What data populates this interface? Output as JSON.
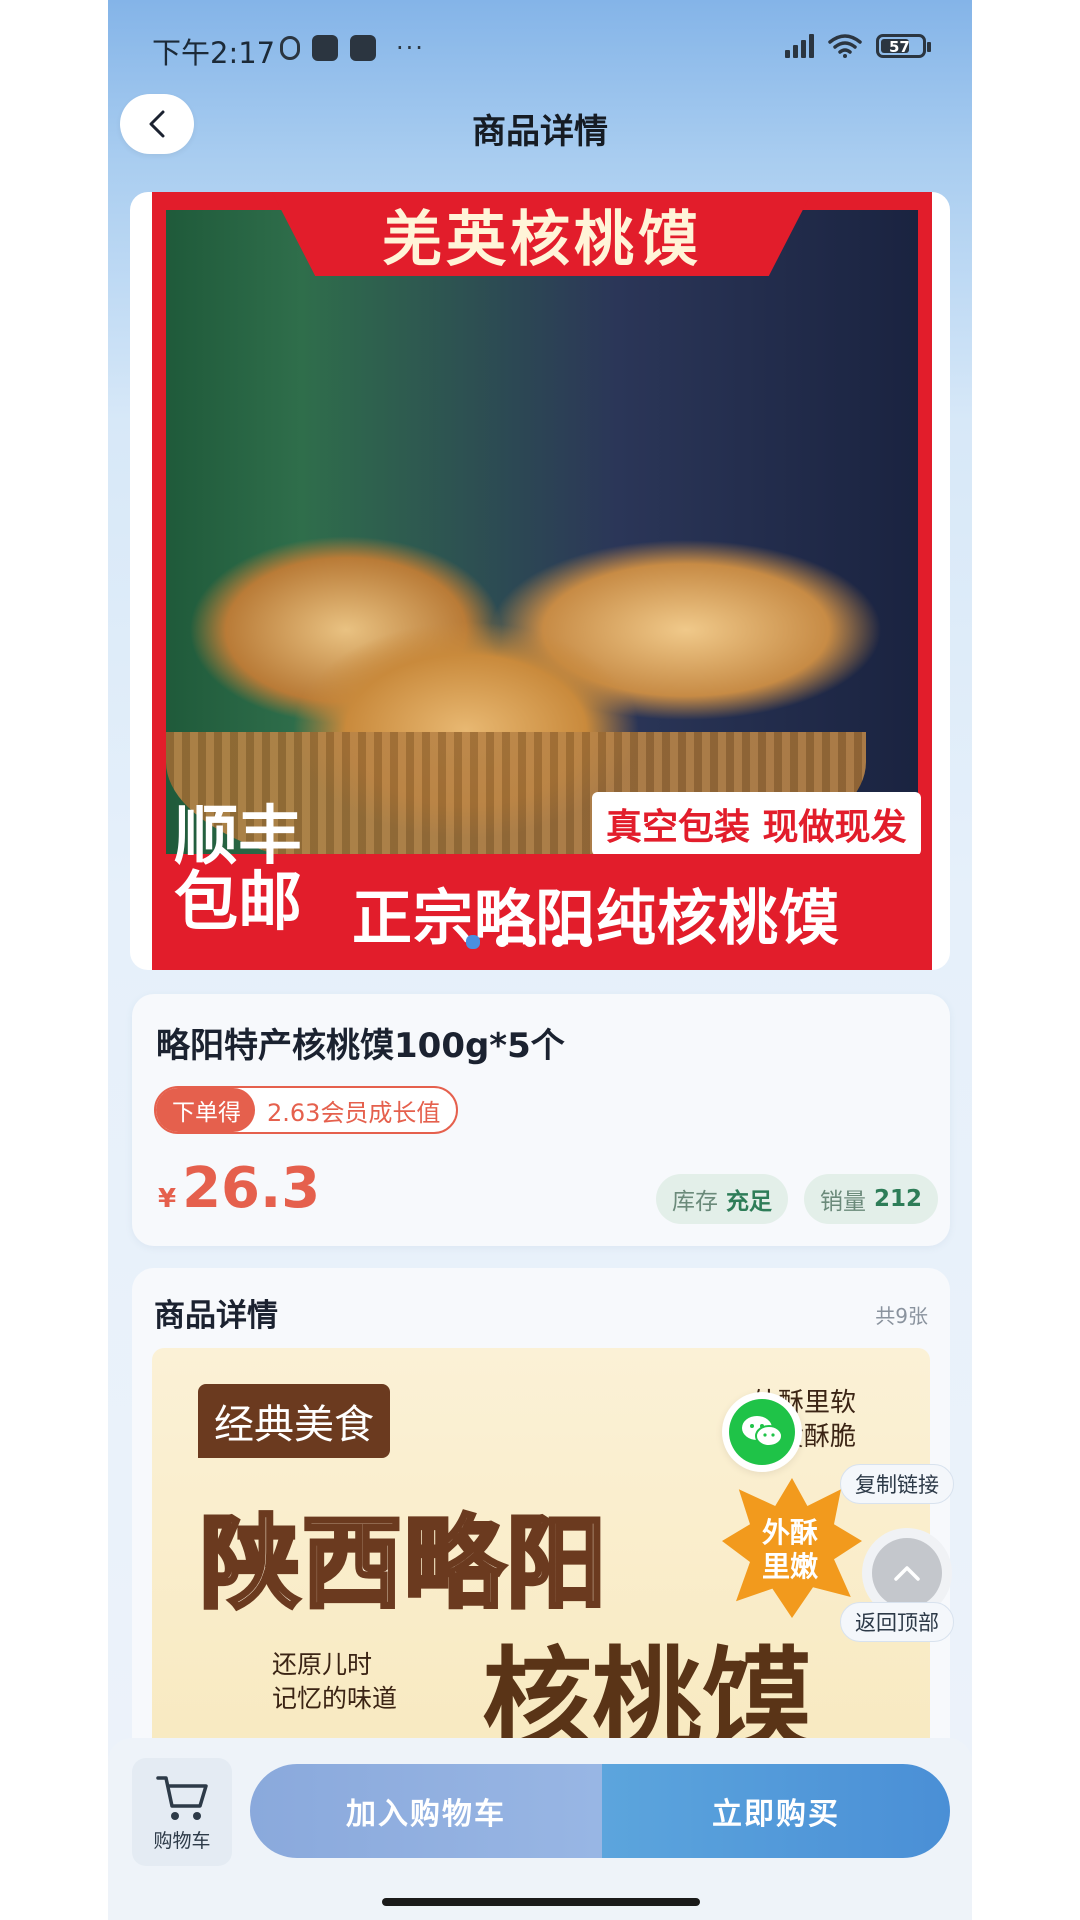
{
  "status_bar": {
    "time": "下午2:17",
    "battery": "57",
    "more": "···"
  },
  "header": {
    "title": "商品详情"
  },
  "hero": {
    "banner_top": "羌英核桃馍",
    "tag": "真空包装 现做现发",
    "shipping": "顺丰包邮",
    "main_text": "正宗略阳纯核桃馍",
    "slide_count": 5,
    "active_slide": 1
  },
  "product": {
    "name": "略阳特产核桃馍100g*5个",
    "growth_prefix": "下单得",
    "growth_value": "2.63会员成长值",
    "price_symbol": "¥",
    "price": "26.3",
    "stock_key": "库存",
    "stock_value": "充足",
    "sales_key": "销量",
    "sales_value": "212"
  },
  "details": {
    "title": "商品详情",
    "count": "共9张",
    "image": {
      "tag": "经典美食",
      "title": "陕西略阳",
      "subtitle_line1": "还原儿时",
      "subtitle_line2": "记忆的味道",
      "big": "核桃馍",
      "crisp_line1": "外酥里软",
      "crisp_line2": "金黄酥脆",
      "star_line1": "外酥",
      "star_line2": "里嫩"
    }
  },
  "floating": {
    "copy_link": "复制链接",
    "back_top": "返回顶部"
  },
  "bottom_bar": {
    "cart_label": "购物车",
    "add_to_cart": "加入购物车",
    "buy_now": "立即购买"
  },
  "colors": {
    "accent_red": "#e5604d",
    "accent_blue": "#4a8fd6",
    "wechat_green": "#1fc348"
  }
}
